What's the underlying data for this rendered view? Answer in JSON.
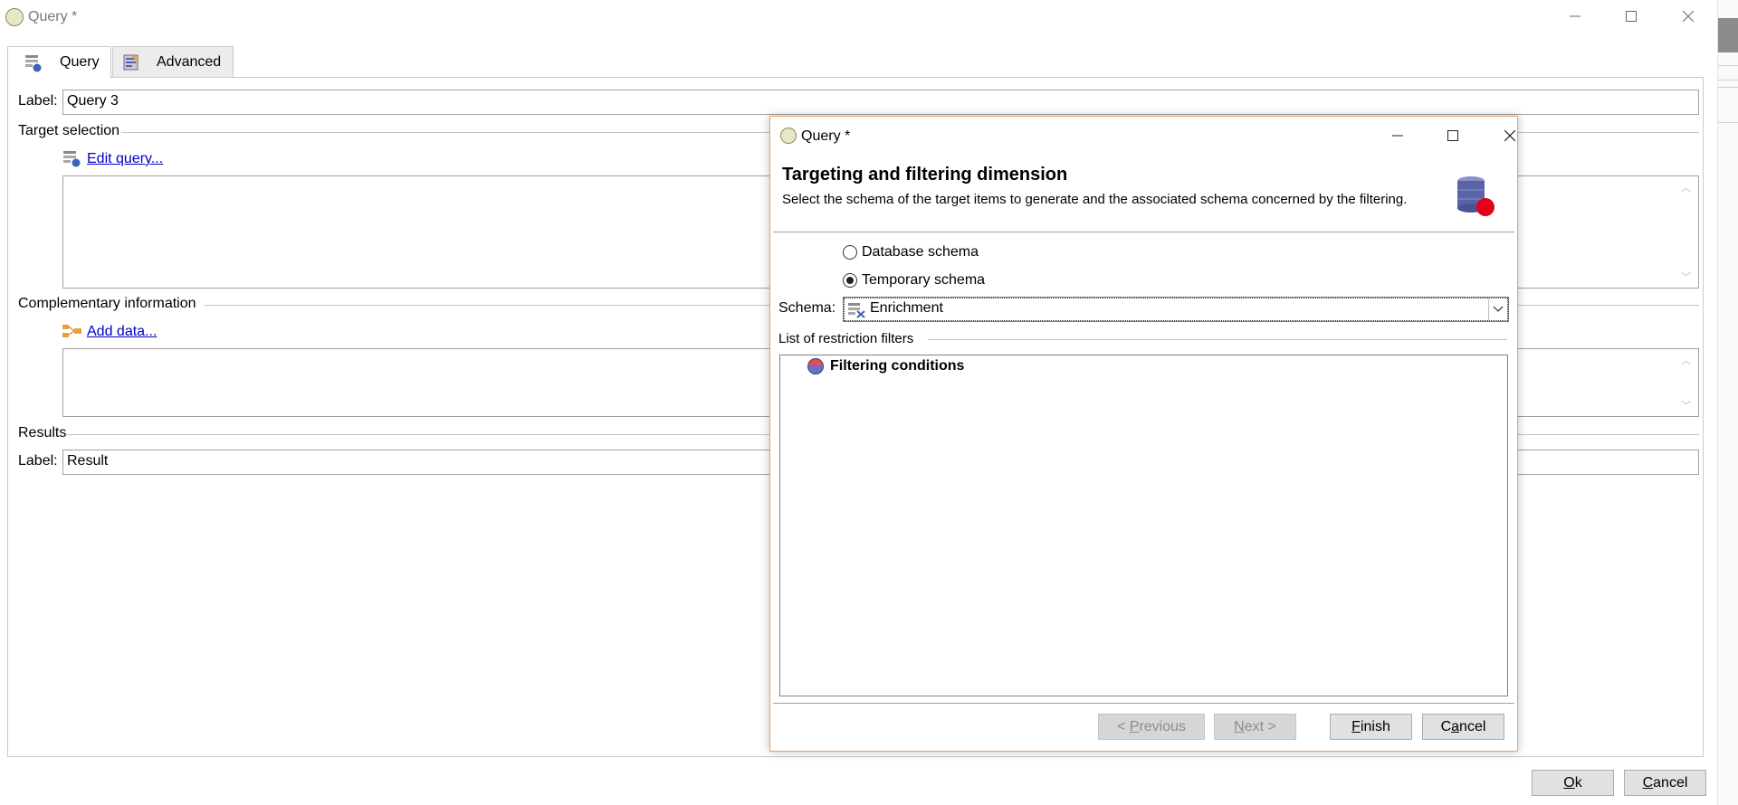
{
  "window": {
    "title": "Query *",
    "minimize_glyph": "—",
    "maximize_glyph": "☐",
    "close_glyph": "✕"
  },
  "tabs": [
    {
      "label": "Query",
      "icon": "query-icon",
      "active": true
    },
    {
      "label": "Advanced",
      "icon": "advanced-icon",
      "active": false
    }
  ],
  "form": {
    "label_caption": "Label:",
    "label_value": "Query 3",
    "target_selection_title": "Target selection",
    "edit_query_link": "Edit query...",
    "complementary_title": "Complementary information",
    "add_data_link": "Add data...",
    "results_title": "Results",
    "result_label_caption": "Label:",
    "result_label_value": "Result"
  },
  "footer": {
    "ok_label": "Ok",
    "ok_accel": "O",
    "ok_rest": "k",
    "cancel_label": "Cancel",
    "cancel_accel": "C",
    "cancel_rest": "ancel"
  },
  "dialog": {
    "title": "Query *",
    "heading": "Targeting and filtering dimension",
    "description": "Select the schema of the target items to  generate and the associated schema concerned by the filtering.",
    "radio_database": "Database schema",
    "radio_temporary": "Temporary schema",
    "selected_radio": "temporary",
    "schema_caption": "Schema:",
    "schema_value": "Enrichment",
    "restriction_title": "List of restriction filters",
    "tree_root": "Filtering conditions",
    "buttons": {
      "previous": "< Previous",
      "previous_pre": "< ",
      "previous_accel": "P",
      "previous_rest": "revious",
      "next": "Next >",
      "next_accel": "N",
      "next_rest": "ext >",
      "finish": "Finish",
      "finish_accel": "F",
      "finish_rest": "inish",
      "cancel": "Cancel",
      "cancel_pre": "C",
      "cancel_accel": "a",
      "cancel_rest": "ncel"
    }
  },
  "colors": {
    "link": "#0000cc",
    "dialog_border": "#e3a36b",
    "database_icon_red": "#e3001b",
    "database_icon_body": "#5a62a8"
  }
}
